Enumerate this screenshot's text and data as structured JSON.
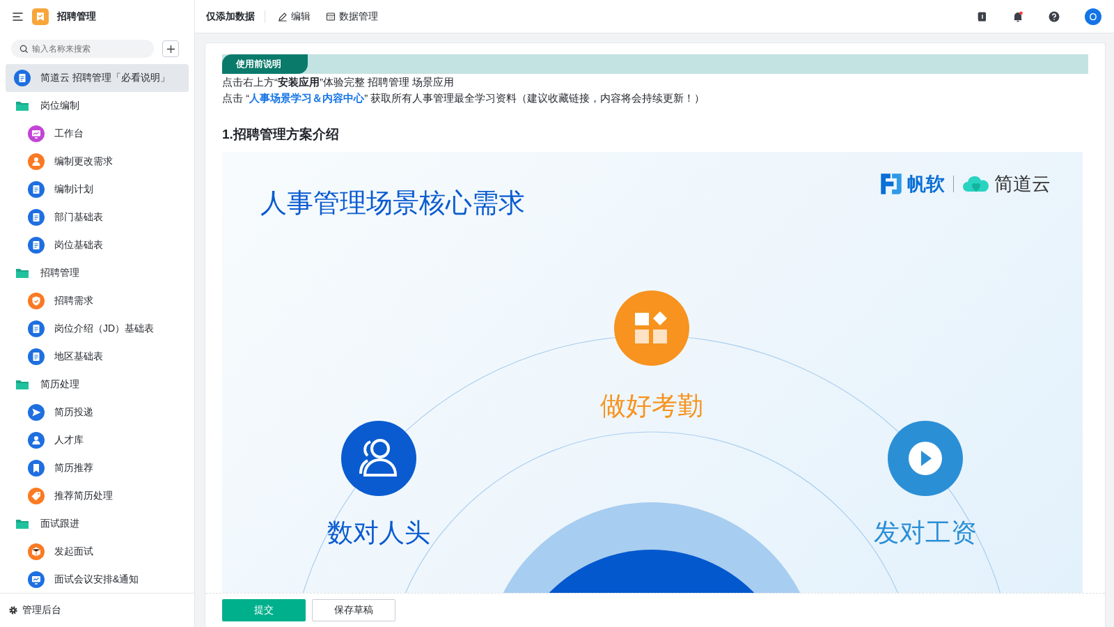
{
  "app": {
    "title": "招聘管理"
  },
  "search": {
    "placeholder": "输入名称来搜索"
  },
  "sidebar": {
    "items": [
      {
        "label": "简道云 招聘管理「必看说明」",
        "kind": "doc",
        "color": "#1e6fe0",
        "selected": true
      },
      {
        "label": "岗位编制",
        "kind": "folder",
        "selected": false,
        "children": [
          {
            "label": "工作台",
            "kind": "dashboard",
            "color": "#c344d6",
            "selected": false
          },
          {
            "label": "编制更改需求",
            "kind": "person",
            "color": "#fa7a23",
            "selected": false
          },
          {
            "label": "编制计划",
            "kind": "doc",
            "color": "#1e6fe0",
            "selected": false
          },
          {
            "label": "部门基础表",
            "kind": "doc",
            "color": "#1e6fe0",
            "selected": false
          },
          {
            "label": "岗位基础表",
            "kind": "doc",
            "color": "#1e6fe0",
            "selected": false
          }
        ]
      },
      {
        "label": "招聘管理",
        "kind": "folder",
        "selected": false,
        "children": [
          {
            "label": "招聘需求",
            "kind": "shield",
            "color": "#fa7a23",
            "selected": false
          },
          {
            "label": "岗位介绍（JD）基础表",
            "kind": "doc",
            "color": "#1e6fe0",
            "selected": false
          },
          {
            "label": "地区基础表",
            "kind": "doc",
            "color": "#1e6fe0",
            "selected": false
          }
        ]
      },
      {
        "label": "简历处理",
        "kind": "folder",
        "selected": false,
        "children": [
          {
            "label": "简历投递",
            "kind": "send",
            "color": "#1e6fe0",
            "selected": false
          },
          {
            "label": "人才库",
            "kind": "person",
            "color": "#1e6fe0",
            "selected": false
          },
          {
            "label": "简历推荐",
            "kind": "bookmark",
            "color": "#1e6fe0",
            "selected": false
          },
          {
            "label": "推荐简历处理",
            "kind": "tag",
            "color": "#fa7a23",
            "selected": false
          }
        ]
      },
      {
        "label": "面试跟进",
        "kind": "folder",
        "selected": false,
        "children": [
          {
            "label": "发起面试",
            "kind": "box",
            "color": "#fa7a23",
            "selected": false
          },
          {
            "label": "面试会议安排&通知",
            "kind": "dashboard",
            "color": "#1e6fe0",
            "selected": false
          }
        ]
      }
    ],
    "admin": "管理后台"
  },
  "toolbar": {
    "title": "仅添加数据",
    "actions": [
      {
        "label": "编辑",
        "kind": "edit"
      },
      {
        "label": "数据管理",
        "kind": "table"
      }
    ]
  },
  "user": {
    "avatar": "O"
  },
  "notice": {
    "tag": "使用前说明",
    "line_1": "点击右上方“**安装应用**”体验完整 招聘管理 场景应用",
    "line_2": {
      "before": "点击 “",
      "link": "人事场景学习＆内容中心",
      "after": "” 获取所有人事管理最全学习资料（建议收藏链接，内容将会持续更新！）"
    }
  },
  "section": {
    "heading": "1.招聘管理方案介绍"
  },
  "graphic": {
    "title": "人事管理场景核心需求",
    "logo_brand": "帆软",
    "logo_product": "简道云",
    "nodes": [
      {
        "label": "做好考勤",
        "kind": "grid",
        "color": "#f7931e"
      },
      {
        "label": "数对人头",
        "kind": "people",
        "color": "#0a5bd0"
      },
      {
        "label": "发对工资",
        "kind": "play",
        "color": "#2b8fd6"
      }
    ]
  },
  "footer": {
    "buttons": [
      {
        "label": "提交",
        "kind": "primary"
      },
      {
        "label": "保存草稿",
        "kind": "secondary"
      }
    ]
  }
}
